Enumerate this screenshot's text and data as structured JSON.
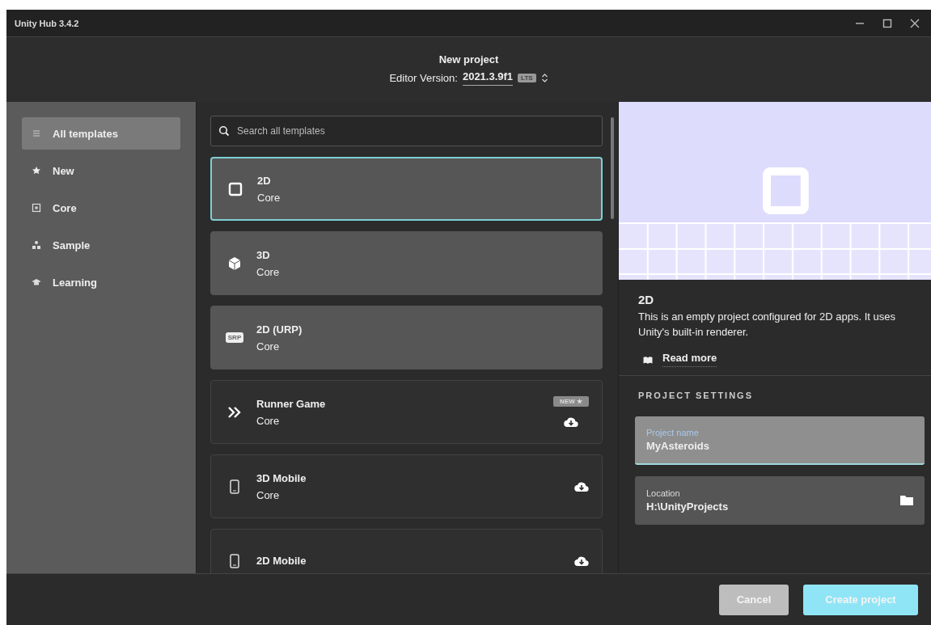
{
  "window": {
    "title": "Unity Hub 3.4.2"
  },
  "header": {
    "title": "New project",
    "editor_label": "Editor Version:",
    "editor_version": "2021.3.9f1",
    "badge": "LTS"
  },
  "sidebar": {
    "items": [
      {
        "label": "All templates",
        "kind": "list",
        "selected": true
      },
      {
        "label": "New",
        "kind": "star",
        "selected": false
      },
      {
        "label": "Core",
        "kind": "core",
        "selected": false
      },
      {
        "label": "Sample",
        "kind": "sample",
        "selected": false
      },
      {
        "label": "Learning",
        "kind": "learning",
        "selected": false
      }
    ]
  },
  "search": {
    "placeholder": "Search all templates"
  },
  "templates": [
    {
      "title": "2D",
      "subtitle": "Core",
      "kind": "square",
      "installed": true,
      "selected": true
    },
    {
      "title": "3D",
      "subtitle": "Core",
      "kind": "cube",
      "installed": true,
      "selected": false
    },
    {
      "title": "2D (URP)",
      "subtitle": "Core",
      "kind": "srp",
      "icon_text": "SRP",
      "installed": true,
      "selected": false
    },
    {
      "title": "Runner Game",
      "subtitle": "Core",
      "kind": "chevrons",
      "installed": false,
      "selected": false,
      "badge": "NEW ★"
    },
    {
      "title": "3D Mobile",
      "subtitle": "Core",
      "kind": "phone",
      "installed": false,
      "selected": false
    },
    {
      "title": "2D Mobile",
      "kind": "phone",
      "installed": false,
      "selected": false
    }
  ],
  "details": {
    "title": "2D",
    "description": "This is an empty project configured for 2D apps. It uses Unity's built-in renderer.",
    "link": "Read more"
  },
  "settings": {
    "heading": "PROJECT SETTINGS",
    "fields": [
      {
        "label": "Project name",
        "value": "MyAsteroids",
        "focused": true
      },
      {
        "label": "Location",
        "value": "H:\\UnityProjects",
        "focused": false,
        "folder": true
      }
    ]
  },
  "buttons": [
    {
      "label": "Cancel",
      "kind": "secondary"
    },
    {
      "label": "Create project",
      "kind": "primary"
    }
  ]
}
